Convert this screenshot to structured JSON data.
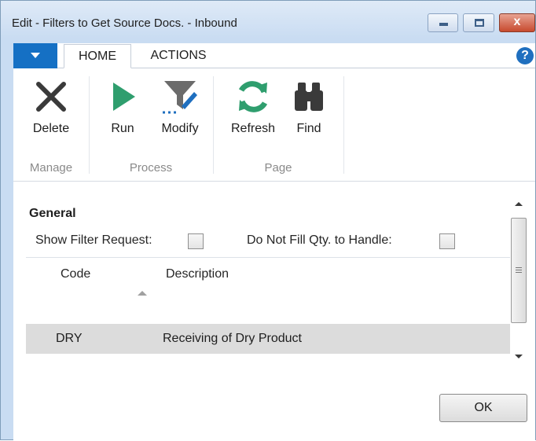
{
  "window": {
    "title": "Edit - Filters to Get Source Docs. - Inbound",
    "min_glyph": "",
    "max_glyph": "",
    "close_glyph": "x"
  },
  "ribbon_tabs": {
    "home": "HOME",
    "actions": "ACTIONS",
    "help": "?"
  },
  "ribbon": {
    "groups": {
      "manage": "Manage",
      "process": "Process",
      "page": "Page"
    },
    "buttons": {
      "delete": {
        "label": "Delete",
        "icon": "delete-x-icon"
      },
      "run": {
        "label": "Run",
        "icon": "play-icon"
      },
      "modify": {
        "label": "Modify",
        "icon": "filter-edit-icon"
      },
      "refresh": {
        "label": "Refresh",
        "icon": "refresh-icon"
      },
      "find": {
        "label": "Find",
        "icon": "binoculars-icon"
      }
    }
  },
  "general": {
    "title": "General",
    "show_filter_request": {
      "label": "Show Filter Request:",
      "checked": false
    },
    "do_not_fill_qty": {
      "label": "Do Not Fill Qty. to Handle:",
      "checked": false
    }
  },
  "grid": {
    "columns": [
      "Code",
      "Description"
    ],
    "rows": [
      {
        "code": "DRY",
        "description": "Receiving of Dry Product"
      }
    ]
  },
  "footer": {
    "ok_label": "OK"
  },
  "colors": {
    "accent": "#1570c4",
    "selected_row": "#dcdcdc",
    "icon_dark": "#3a3a3a",
    "icon_green": "#2f9e6e"
  }
}
